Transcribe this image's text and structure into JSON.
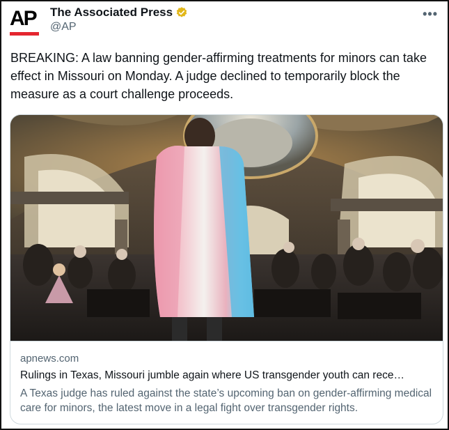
{
  "author": {
    "avatar_text": "AP",
    "display_name": "The Associated Press",
    "handle": "@AP",
    "verified": true,
    "accent_color": "#e4262f",
    "badge_color": "#e2b719"
  },
  "menu": {
    "more_label": "•••"
  },
  "tweet": {
    "text": "BREAKING: A law banning gender-affirming treatments for minors can take effect in Missouri on Monday. A judge declined to temporarily block the measure as a court challenge proceeds."
  },
  "card": {
    "domain": "apnews.com",
    "title": "Rulings in Texas, Missouri jumble again where US transgender youth can rece…",
    "description": "A Texas judge has ruled against the state’s upcoming ban on gender-affirming medical care for minors, the latest move in a legal fight over transgender rights.",
    "image_subject": "person wrapped in transgender pride flag in capitol rotunda",
    "flag_colors": [
      "#5bcefa",
      "#f5a9b8",
      "#ffffff",
      "#f5a9b8",
      "#5bcefa"
    ]
  }
}
